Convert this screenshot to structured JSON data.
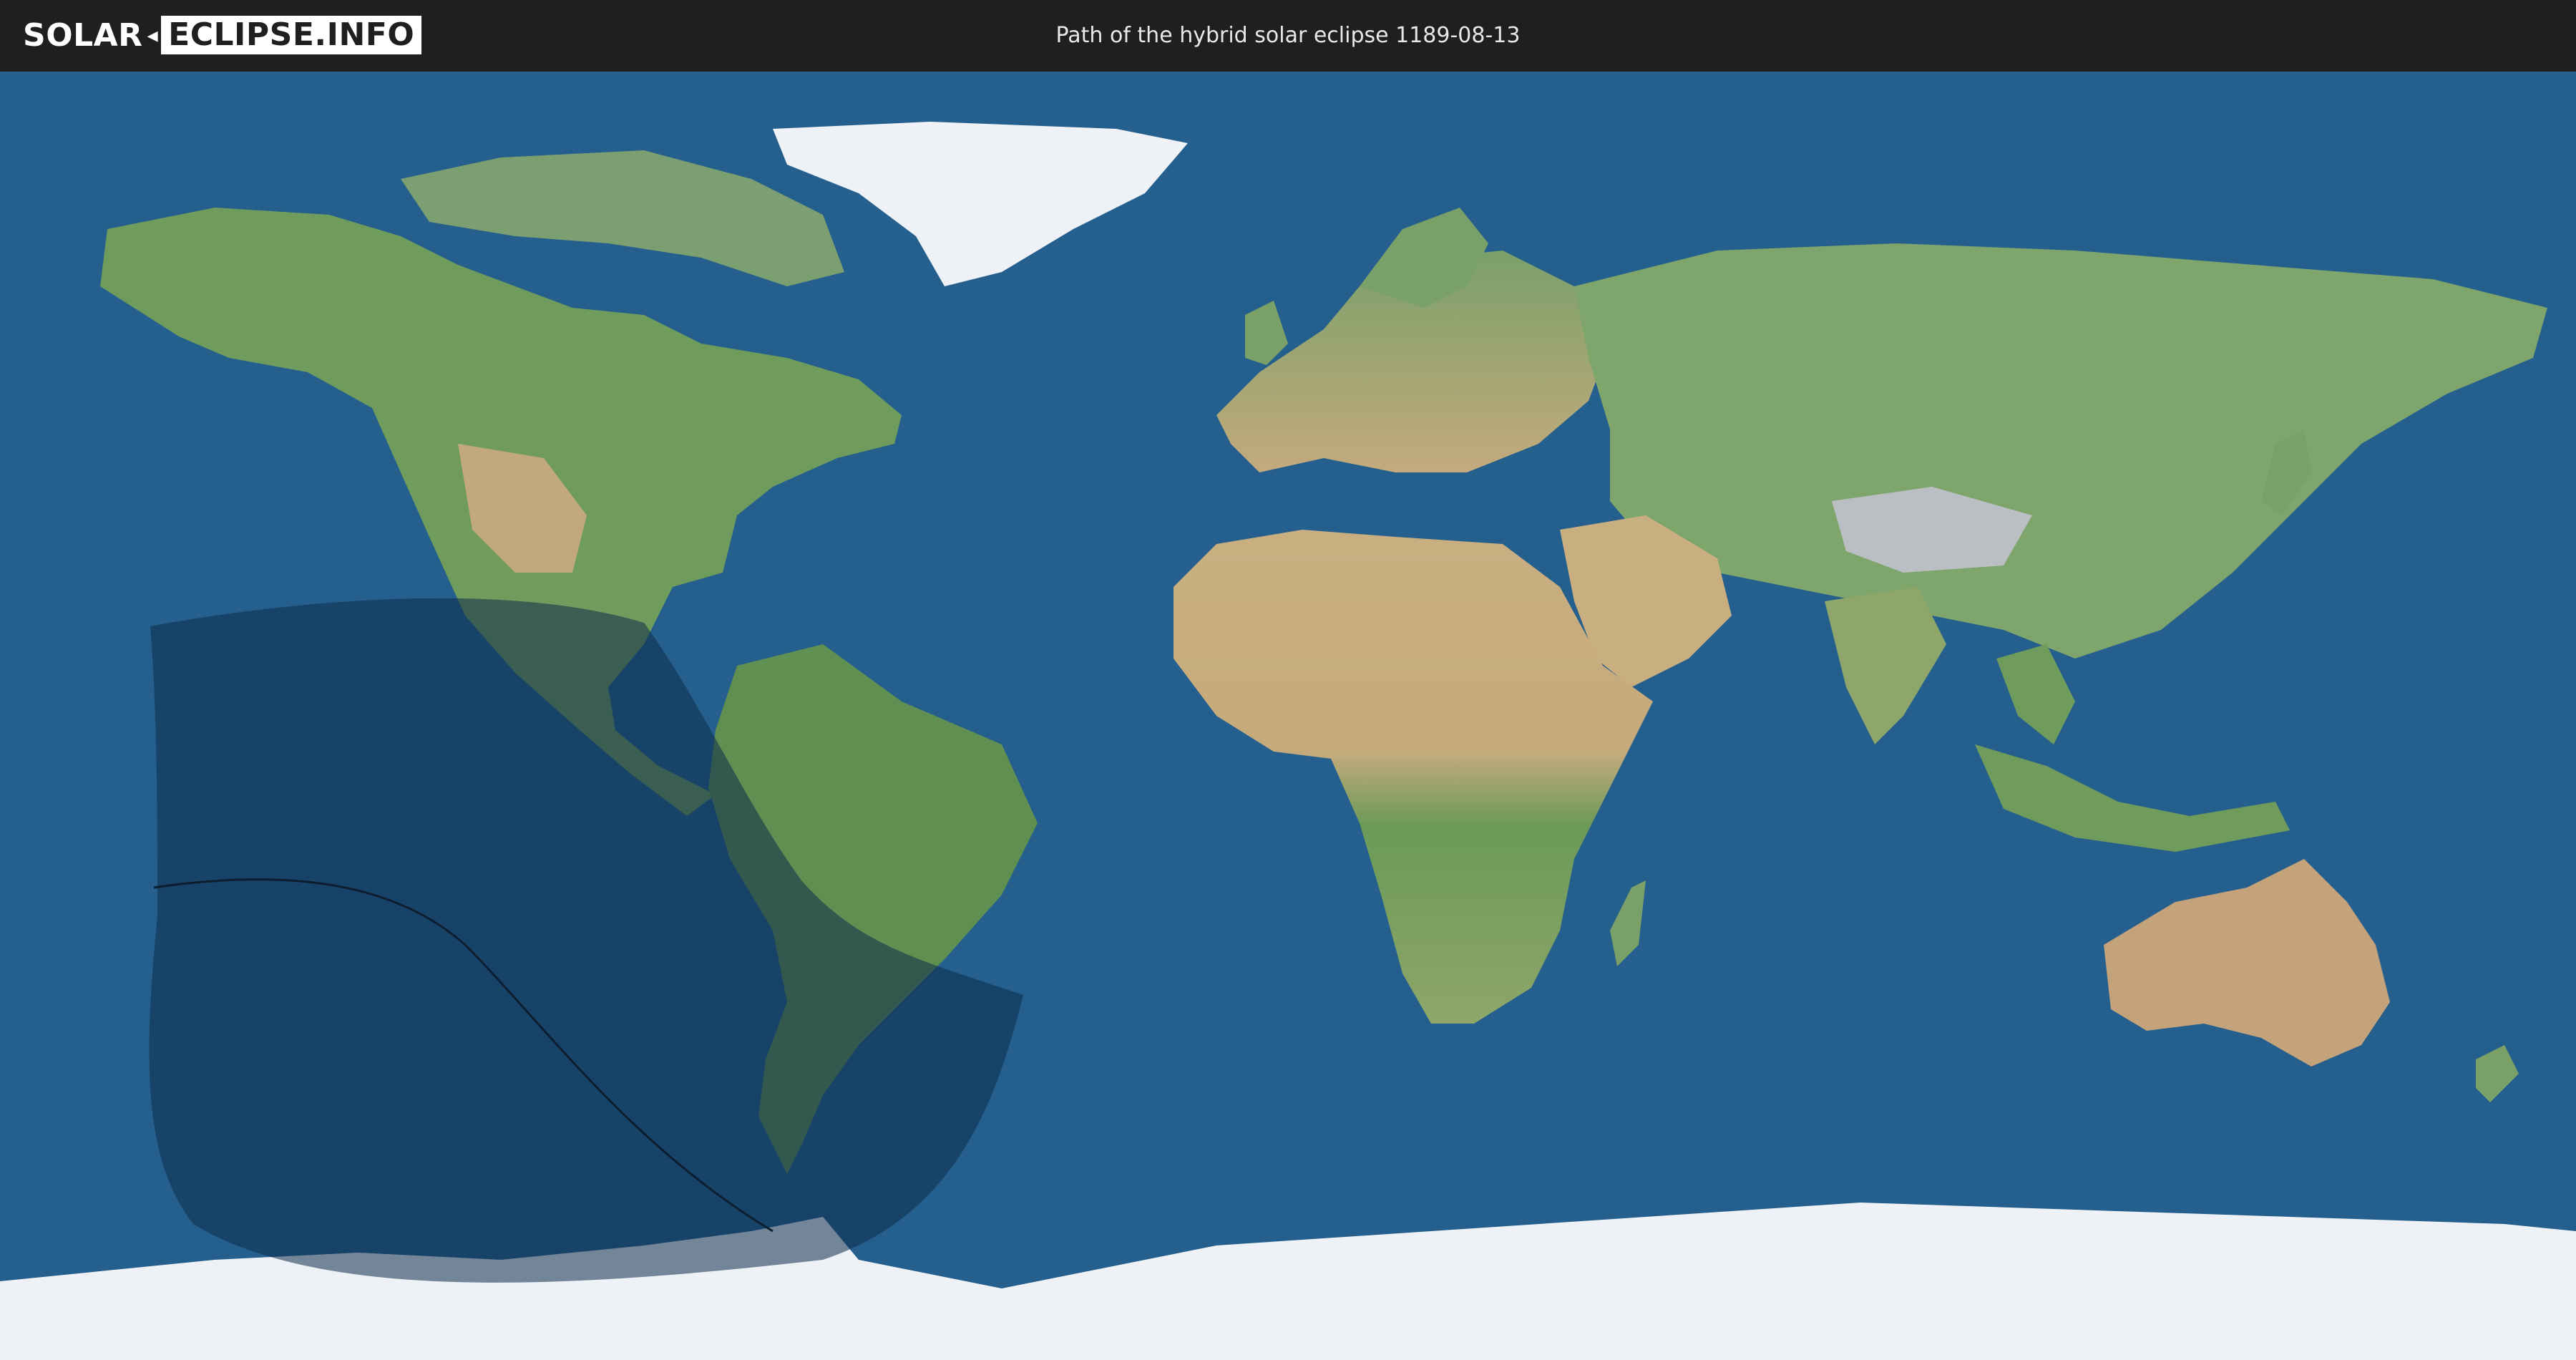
{
  "header": {
    "logo_left": "SOLAR",
    "logo_right": "ECLIPSE.INFO",
    "title": "Path of the hybrid solar eclipse 1189-08-13"
  },
  "colors": {
    "ocean": "#255f8d",
    "land_green": "#6f9c5c",
    "land_desert": "#c8ad7f",
    "ice": "#eef2f6",
    "eclipse_overlay": "#0f2c4a",
    "central_line": "#0c1e30",
    "header_bg": "#1f1f1f"
  },
  "map": {
    "projection": "equirectangular",
    "icons": [
      "eclipse-visibility-area",
      "central-path-line"
    ]
  }
}
